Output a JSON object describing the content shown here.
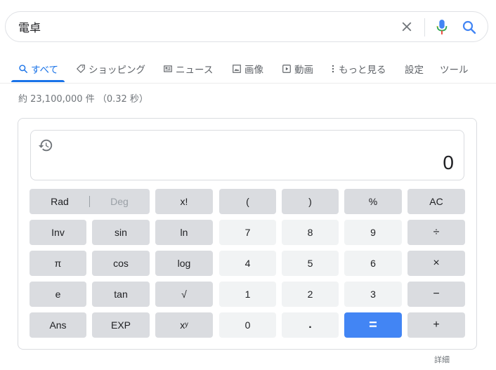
{
  "search": {
    "query": "電卓",
    "clear_label": "×"
  },
  "tabs": [
    {
      "label": "すべて",
      "active": true,
      "icon": "search-icon"
    },
    {
      "label": "ショッピング",
      "active": false,
      "icon": "tag-icon"
    },
    {
      "label": "ニュース",
      "active": false,
      "icon": "news-icon"
    },
    {
      "label": "画像",
      "active": false,
      "icon": "image-icon"
    },
    {
      "label": "動画",
      "active": false,
      "icon": "video-icon"
    },
    {
      "label": "もっと見る",
      "active": false,
      "icon": "more-vert-icon"
    },
    {
      "label": "設定",
      "active": false
    },
    {
      "label": "ツール",
      "active": false
    }
  ],
  "result_stats": "約 23,100,000 件 （0.32 秒）",
  "calculator": {
    "display_value": "0",
    "keys": {
      "rad": "Rad",
      "deg": "Deg",
      "factorial": "x!",
      "open_paren": "(",
      "close_paren": ")",
      "percent": "%",
      "all_clear": "AC",
      "inv": "Inv",
      "sin": "sin",
      "ln": "ln",
      "seven": "7",
      "eight": "8",
      "nine": "9",
      "divide": "÷",
      "pi": "π",
      "cos": "cos",
      "log": "log",
      "four": "4",
      "five": "5",
      "six": "6",
      "multiply": "×",
      "e": "e",
      "tan": "tan",
      "sqrt": "√",
      "one": "1",
      "two": "2",
      "three": "3",
      "minus": "−",
      "ans": "Ans",
      "exp": "EXP",
      "power": "xʸ",
      "zero": "0",
      "decimal": ".",
      "equals": "=",
      "plus": "+"
    }
  },
  "details_link": "詳細",
  "colors": {
    "accent": "#1a73e8",
    "equals_key": "#4285f4",
    "dark_key": "#dadce0",
    "light_key": "#f1f3f4"
  }
}
